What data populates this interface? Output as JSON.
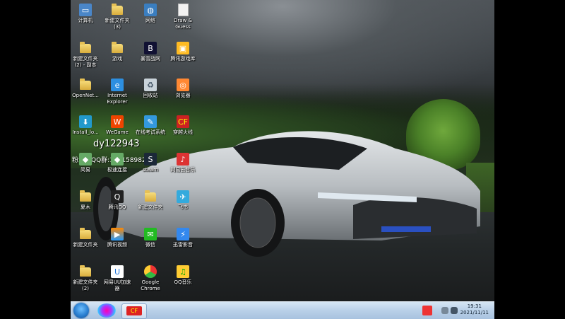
{
  "desktop_icons": [
    {
      "id": "computer",
      "label": "计算机",
      "icon": "computer-icon"
    },
    {
      "id": "new-folder-3",
      "label": "新建文件夹\n(3)",
      "icon": "folder-icon"
    },
    {
      "id": "network",
      "label": "网络",
      "icon": "network-icon"
    },
    {
      "id": "draw-guess",
      "label": "Draw &\nGuess",
      "icon": "game-shortcut-icon"
    },
    {
      "id": "new-folder-2-copy",
      "label": "新建文件夹\n(2) - 副本",
      "icon": "folder-icon"
    },
    {
      "id": "games",
      "label": "游戏",
      "icon": "folder-icon"
    },
    {
      "id": "battle-net",
      "label": "暴雪战网",
      "icon": "battlenet-icon"
    },
    {
      "id": "tencent-game-lib",
      "label": "腾讯游戏库",
      "icon": "tencent-gamelib-icon"
    },
    {
      "id": "opennet",
      "label": "OpenNet...",
      "icon": "folder-icon"
    },
    {
      "id": "ie",
      "label": "Internet\nExplorer",
      "icon": "internet-explorer-icon"
    },
    {
      "id": "recycle",
      "label": "回收站",
      "icon": "recycle-bin-icon"
    },
    {
      "id": "browser",
      "label": "浏览器",
      "icon": "browser-icon"
    },
    {
      "id": "install",
      "label": "Install_lo...",
      "icon": "installer-icon"
    },
    {
      "id": "wegame",
      "label": "WeGame",
      "icon": "wegame-icon"
    },
    {
      "id": "exam",
      "label": "在线考试系统",
      "icon": "exam-system-icon"
    },
    {
      "id": "cf",
      "label": "穿越火线",
      "icon": "crossfire-icon"
    },
    {
      "id": "shortcut-a",
      "label": "简易",
      "icon": "app-icon"
    },
    {
      "id": "shortcut-b",
      "label": "极速连接",
      "icon": "app-icon"
    },
    {
      "id": "steam",
      "label": "steam",
      "icon": "steam-icon"
    },
    {
      "id": "netease-music",
      "label": "网易云音乐",
      "icon": "netease-music-icon"
    },
    {
      "id": "folder-x",
      "label": "夏木",
      "icon": "folder-icon"
    },
    {
      "id": "qq",
      "label": "腾讯QQ",
      "icon": "qq-icon"
    },
    {
      "id": "new-folder",
      "label": "新建文件夹",
      "icon": "folder-icon"
    },
    {
      "id": "feishu",
      "label": "飞书",
      "icon": "feishu-icon"
    },
    {
      "id": "new-folder-b",
      "label": "新建文件夹",
      "icon": "folder-icon"
    },
    {
      "id": "tencent-video",
      "label": "腾讯视频",
      "icon": "tencent-video-icon"
    },
    {
      "id": "wechat",
      "label": "微信",
      "icon": "wechat-icon"
    },
    {
      "id": "xunlei",
      "label": "迅雷影音",
      "icon": "xunlei-icon"
    },
    {
      "id": "new-folder-2",
      "label": "新建文件夹\n(2)",
      "icon": "folder-icon"
    },
    {
      "id": "uu",
      "label": "网易UU加速\n器",
      "icon": "uu-accelerator-icon"
    },
    {
      "id": "chrome",
      "label": "Google\nChrome",
      "icon": "chrome-icon"
    },
    {
      "id": "qqmusic",
      "label": "QQ音乐",
      "icon": "qq-music-icon"
    }
  ],
  "overlay": {
    "line1": "dy122943",
    "line2": "粉丝群QQ群:1171589823"
  },
  "taskbar": {
    "start": "start-orb-icon",
    "pinned": [
      "colorful-app-icon",
      "crossfire-icon"
    ],
    "tray_time": "19:31",
    "tray_date": "2021/11/11"
  },
  "colors": {
    "taskbar": "#b9d0e8",
    "folder": "#e7c155",
    "car": "#b9bdc0"
  }
}
